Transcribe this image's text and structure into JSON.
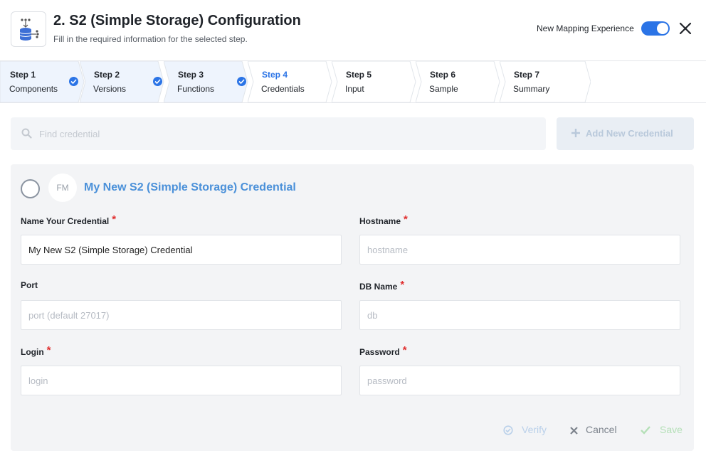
{
  "header": {
    "title": "2. S2 (Simple Storage) Configuration",
    "subtitle": "Fill in the required information for the selected step.",
    "toggle_label": "New Mapping Experience",
    "toggle_on": true,
    "accent_color": "#2b74e6"
  },
  "steps": [
    {
      "num": "Step 1",
      "name": "Components",
      "state": "completed"
    },
    {
      "num": "Step 2",
      "name": "Versions",
      "state": "completed"
    },
    {
      "num": "Step 3",
      "name": "Functions",
      "state": "completed"
    },
    {
      "num": "Step 4",
      "name": "Credentials",
      "state": "active"
    },
    {
      "num": "Step 5",
      "name": "Input",
      "state": "pending"
    },
    {
      "num": "Step 6",
      "name": "Sample",
      "state": "pending"
    },
    {
      "num": "Step 7",
      "name": "Summary",
      "state": "pending"
    }
  ],
  "search": {
    "placeholder": "Find credential",
    "icon": "search-icon"
  },
  "add_button": {
    "label": "Add New Credential",
    "icon": "plus-icon"
  },
  "credential": {
    "avatar_initials": "FM",
    "title": "My New S2 (Simple Storage) Credential",
    "fields": {
      "name": {
        "label": "Name Your Credential",
        "value": "My New S2 (Simple Storage) Credential",
        "placeholder": "",
        "required": true
      },
      "hostname": {
        "label": "Hostname",
        "value": "",
        "placeholder": "hostname",
        "required": true
      },
      "port": {
        "label": "Port",
        "value": "",
        "placeholder": "port (default 27017)",
        "required": false
      },
      "dbname": {
        "label": "DB Name",
        "value": "",
        "placeholder": "db",
        "required": true
      },
      "login": {
        "label": "Login",
        "value": "",
        "placeholder": "login",
        "required": true
      },
      "password": {
        "label": "Password",
        "value": "",
        "placeholder": "password",
        "required": true
      }
    },
    "required_marker": "*"
  },
  "actions": {
    "verify": "Verify",
    "cancel": "Cancel",
    "save": "Save"
  }
}
